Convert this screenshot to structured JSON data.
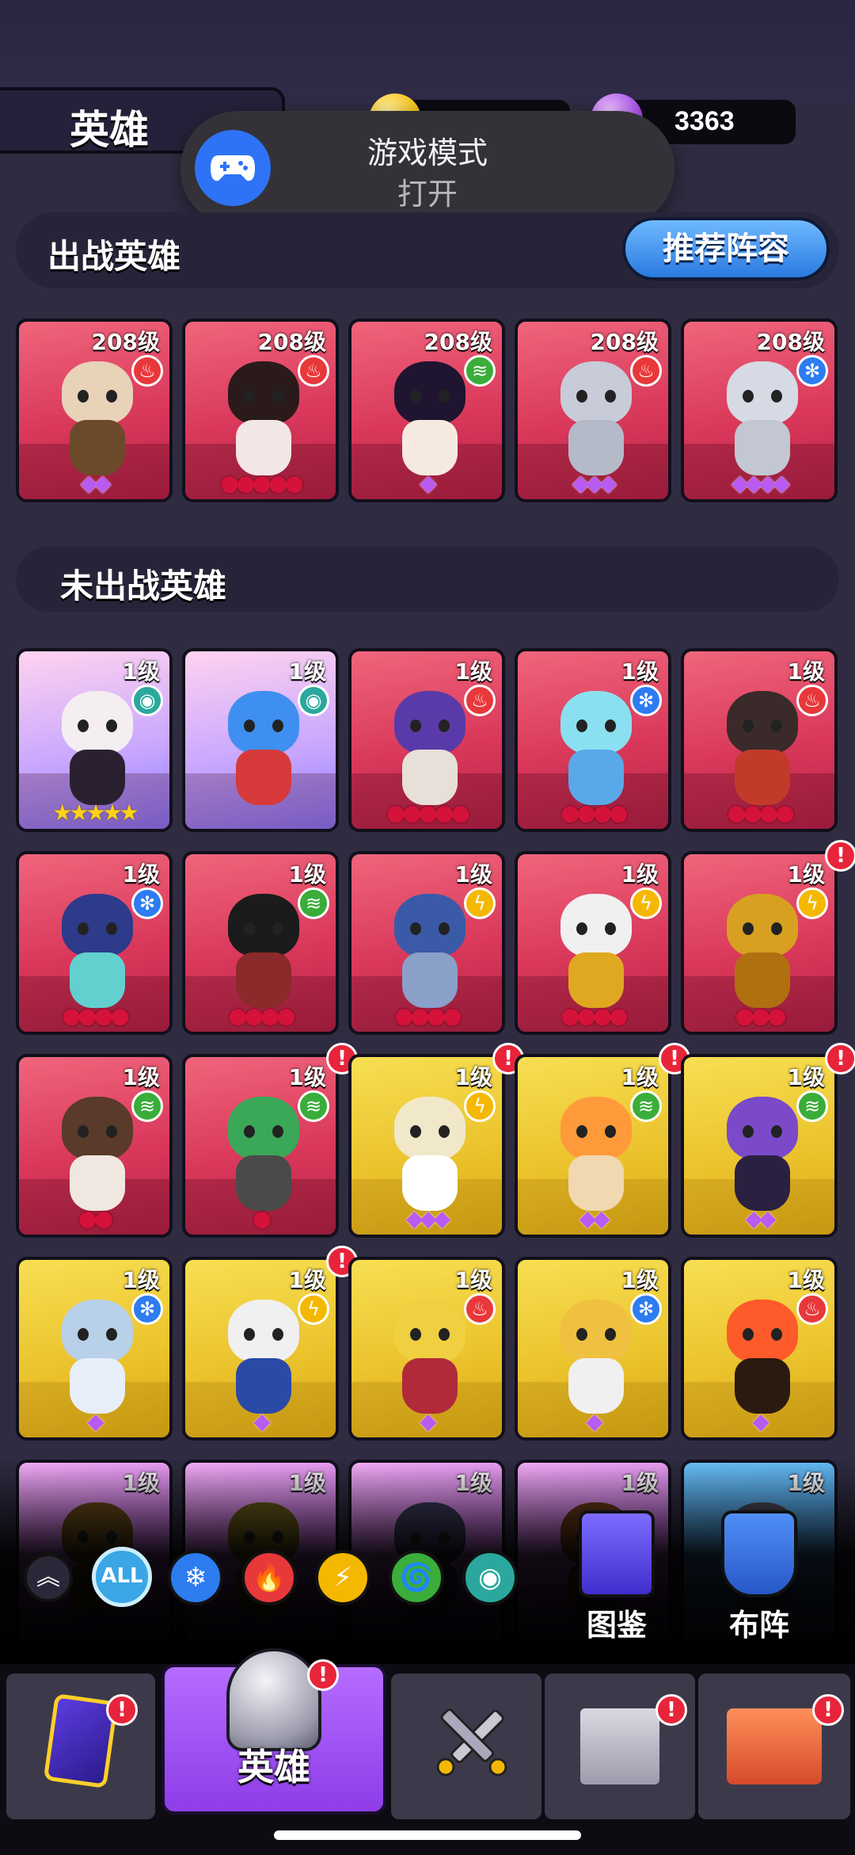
{
  "header": {
    "title": "英雄",
    "gold_value": "",
    "gem_value": "3363"
  },
  "toast": {
    "title": "游戏模式",
    "status": "打开"
  },
  "deployed_section": {
    "label": "出战英雄",
    "recommend_button": "推荐阵容"
  },
  "undeployed_section": {
    "label": "未出战英雄"
  },
  "deployed_heroes": [
    {
      "level": "208级",
      "element": "fire",
      "rank": "◆◆"
    },
    {
      "level": "208级",
      "element": "fire",
      "rank": "●●●●●"
    },
    {
      "level": "208级",
      "element": "wind",
      "rank": "◆"
    },
    {
      "level": "208级",
      "element": "fire",
      "rank": "◆◆◆"
    },
    {
      "level": "208级",
      "element": "ice",
      "rank": "◆◆◆◆"
    }
  ],
  "undeployed_heroes": [
    {
      "level": "1级",
      "element": "eye",
      "rank": "★★★★★"
    },
    {
      "level": "1级",
      "element": "eye",
      "rank": ""
    },
    {
      "level": "1级",
      "element": "fire",
      "rank": "●●●●●"
    },
    {
      "level": "1级",
      "element": "ice",
      "rank": "●●●●"
    },
    {
      "level": "1级",
      "element": "fire",
      "rank": "●●●●"
    },
    {
      "level": "1级",
      "element": "ice",
      "rank": "●●●●"
    },
    {
      "level": "1级",
      "element": "wind",
      "rank": "●●●●"
    },
    {
      "level": "1级",
      "element": "thunder",
      "rank": "●●●●"
    },
    {
      "level": "1级",
      "element": "thunder",
      "rank": "●●●●"
    },
    {
      "level": "1级",
      "element": "thunder",
      "rank": "●●●"
    },
    {
      "level": "1级",
      "element": "wind",
      "rank": "●●"
    },
    {
      "level": "1级",
      "element": "wind",
      "rank": "●"
    },
    {
      "level": "1级",
      "element": "thunder",
      "rank": "◆◆◆"
    },
    {
      "level": "1级",
      "element": "wind",
      "rank": "◆◆"
    },
    {
      "level": "1级",
      "element": "wind",
      "rank": "◆◆"
    },
    {
      "level": "1级",
      "element": "ice",
      "rank": "◆"
    },
    {
      "level": "1级",
      "element": "thunder",
      "rank": "◆"
    },
    {
      "level": "1级",
      "element": "fire",
      "rank": "◆"
    },
    {
      "level": "1级",
      "element": "ice",
      "rank": "◆"
    },
    {
      "level": "1级",
      "element": "fire",
      "rank": "◆"
    },
    {
      "level": "1级",
      "element": "",
      "rank": ""
    },
    {
      "level": "1级",
      "element": "",
      "rank": ""
    },
    {
      "level": "1级",
      "element": "",
      "rank": ""
    },
    {
      "level": "1级",
      "element": "",
      "rank": ""
    },
    {
      "level": "1级",
      "element": "",
      "rank": ""
    }
  ],
  "filters": {
    "collapse": "︽",
    "all": "ALL",
    "ice": "❄",
    "fire": "🔥",
    "thunder": "⚡",
    "wind": "🌀",
    "eye": "◉"
  },
  "side_buttons": {
    "codex": "图鉴",
    "formation": "布阵"
  },
  "tabbar": {
    "active_label": "英雄"
  },
  "alert_mark": "!",
  "colors": {
    "card_red": "#d9385a",
    "card_yellow": "#eac12b",
    "accent_purple": "#8e3de8",
    "toast_blue": "#2e73f6"
  }
}
